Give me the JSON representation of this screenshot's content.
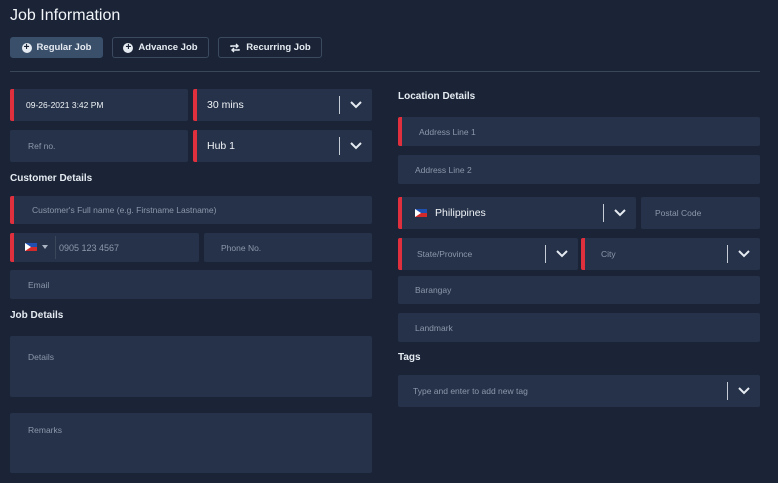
{
  "header": {
    "title": "Job Information",
    "tabs": [
      {
        "label": "Regular Job",
        "icon": "plus-circle-icon",
        "active": true
      },
      {
        "label": "Advance Job",
        "icon": "plus-circle-icon",
        "active": false
      },
      {
        "label": "Recurring Job",
        "icon": "repeat-icon",
        "active": false
      }
    ]
  },
  "schedule": {
    "datetime": "09-26-2021 3:42 PM",
    "duration": "30 mins",
    "ref_placeholder": "Ref no.",
    "hub": "Hub 1"
  },
  "customer": {
    "section_title": "Customer Details",
    "name_placeholder": "Customer's Full name (e.g. Firstname Lastname)",
    "mobile_placeholder": "0905 123 4567",
    "phone_placeholder": "Phone No.",
    "email_placeholder": "Email"
  },
  "job": {
    "section_title": "Job Details",
    "details_placeholder": "Details",
    "remarks_placeholder": "Remarks"
  },
  "location": {
    "section_title": "Location Details",
    "address1_placeholder": "Address Line 1",
    "address2_placeholder": "Address Line 2",
    "country": "Philippines",
    "postal_placeholder": "Postal Code",
    "state_placeholder": "State/Province",
    "city_placeholder": "City",
    "barangay_placeholder": "Barangay",
    "landmark_placeholder": "Landmark"
  },
  "tags": {
    "section_title": "Tags",
    "placeholder": "Type and enter to add new tag"
  },
  "colors": {
    "background": "#1a2436",
    "field": "#253249",
    "required_accent": "#e0303e",
    "active_tab": "#3a4f6a"
  }
}
